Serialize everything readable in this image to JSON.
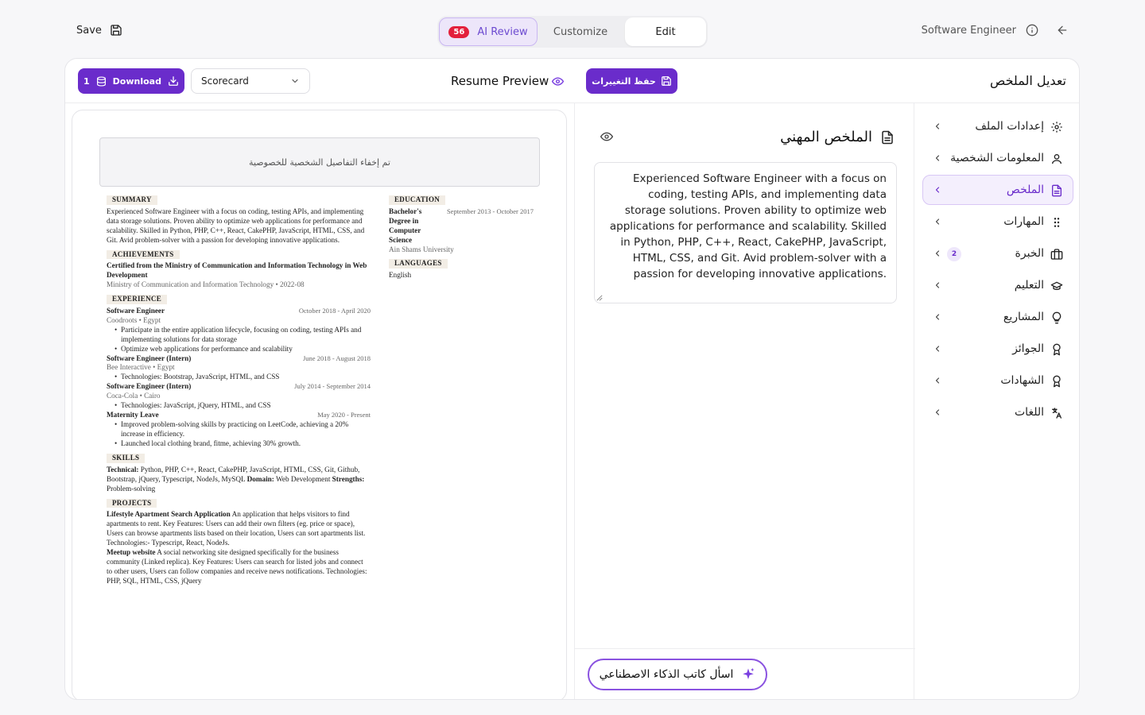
{
  "topbar": {
    "save_label": "Save",
    "tabs": [
      {
        "label": "AI Review",
        "badge": "56"
      },
      {
        "label": "Customize"
      },
      {
        "label": "Edit"
      }
    ],
    "job_title": "Software Engineer"
  },
  "header": {
    "download_label": "Download",
    "download_count": "1",
    "scorecard_value": "Scorecard",
    "preview_title": "Resume Preview",
    "save_changes_label": "حفظ التغييرات",
    "edit_title": "تعديل الملخص"
  },
  "preview": {
    "privacy_text": "تم إخفاء التفاصيل الشخصية للخصوصية",
    "summary": {
      "heading": "SUMMARY",
      "text": "Experienced Software Engineer with a focus on coding, testing APIs, and implementing data storage solutions. Proven ability to optimize web applications for performance and scalability. Skilled in Python, PHP, C++, React, CakePHP, JavaScript, HTML, CSS, and Git. Avid problem-solver with a passion for developing innovative applications."
    },
    "achievements": {
      "heading": "ACHIEVEMENTS",
      "title": "Certified from the Ministry of Communication and Information Technology in Web Development",
      "sub": "Ministry of Communication and Information Technology • 2022-08"
    },
    "experience": {
      "heading": "EXPERIENCE",
      "jobs": [
        {
          "title": "Software Engineer",
          "date": "October 2018 - April 2020",
          "company": "Coodroots • Egypt",
          "bullets": [
            "Participate in the entire application lifecycle, focusing on coding, testing APIs and implementing solutions for data storage",
            "Optimize web applications for performance and scalability"
          ]
        },
        {
          "title": "Software Engineer (Intern)",
          "date": "June 2018 - August 2018",
          "company": "Bee Interactive • Egypt",
          "bullets": [
            "Technologies: Bootstrap, JavaScript, HTML, and CSS"
          ]
        },
        {
          "title": "Software Engineer (Intern)",
          "date": "July 2014 - September 2014",
          "company": "Coca-Cola • Cairo",
          "bullets": [
            "Technologies: JavaScript, jQuery, HTML, and CSS"
          ]
        },
        {
          "title": "Maternity Leave",
          "date": "May 2020 - Present",
          "company": "",
          "bullets": [
            "Improved problem-solving skills by practicing on LeetCode, achieving a 20% increase in efficiency.",
            "Launched local clothing brand, fitme, achieving 30% growth."
          ]
        }
      ]
    },
    "skills": {
      "heading": "SKILLS",
      "technical_label": "Technical:",
      "technical": "Python, PHP, C++, React, CakePHP, JavaScript, HTML, CSS, Git, Github, Bootstrap, jQuery, Typescript, NodeJs, MySQL",
      "domain_label": "Domain:",
      "domain": "Web Development",
      "strengths_label": "Strengths:",
      "strengths": "Problem-solving"
    },
    "projects": {
      "heading": "PROJECTS",
      "items": [
        {
          "title": "Lifestyle Apartment Search Application",
          "text": "An application that helps visitors to find apartments to rent. Key Features: Users can add their own filters (eg. price or space), Users can browse apartments lists based on their location, Users can sort apartments list. Technologies:- Typescript, React, NodeJs."
        },
        {
          "title": "Meetup website",
          "text": "A social networking site designed specifically for the business community (Linked replica). Key Features: Users can search for listed jobs and connect to other users, Users can follow companies and receive news notifications. Technologies: PHP, SQL, HTML, CSS, jQuery"
        }
      ]
    },
    "education": {
      "heading": "EDUCATION",
      "degree": "Bachelor's Degree in Computer Science",
      "date": "September 2013 - October 2017",
      "school": "Ain Shams University"
    },
    "languages": {
      "heading": "LANGUAGES",
      "value": "English"
    }
  },
  "editor": {
    "section_title": "الملخص المهني",
    "summary_text": "Experienced Software Engineer with a focus on coding, testing APIs, and implementing data storage solutions. Proven ability to optimize web applications for performance and scalability. Skilled in Python, PHP, C++, React, CakePHP, JavaScript, HTML, CSS, and Git. Avid problem-solver with a passion for developing innovative applications.",
    "ai_writer_label": "اسأل كاتب الذكاء الاصطناعي"
  },
  "sidebar": {
    "items": [
      {
        "label": "إعدادات الملف",
        "icon": "gear-icon"
      },
      {
        "label": "المعلومات الشخصية",
        "icon": "user-icon"
      },
      {
        "label": "الملخص",
        "icon": "document-icon"
      },
      {
        "label": "المهارات",
        "icon": "grid-dots-icon"
      },
      {
        "label": "الخبرة",
        "icon": "briefcase-icon",
        "badge": "2"
      },
      {
        "label": "التعليم",
        "icon": "graduation-cap-icon"
      },
      {
        "label": "المشاريع",
        "icon": "lightbulb-icon"
      },
      {
        "label": "الجوائز",
        "icon": "award-icon"
      },
      {
        "label": "الشهادات",
        "icon": "certificate-icon"
      },
      {
        "label": "اللغات",
        "icon": "translate-icon"
      }
    ]
  },
  "colors": {
    "accent": "#6a2ccb",
    "badge_red": "#e3203c",
    "active_bg": "#f4effd"
  }
}
